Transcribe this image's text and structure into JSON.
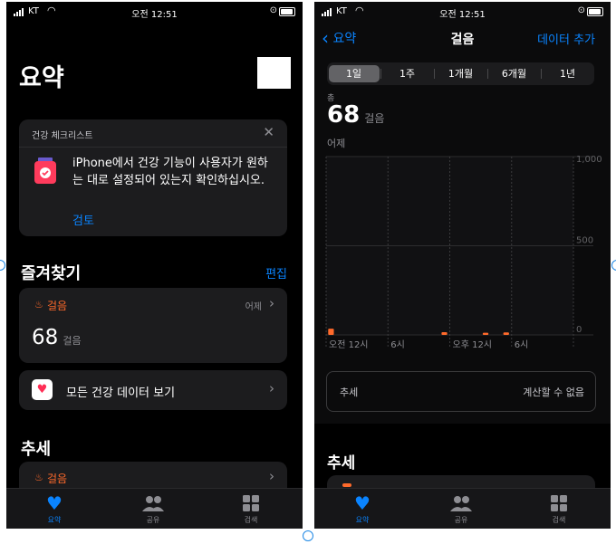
{
  "status_bar": {
    "carrier": "KT",
    "time": "오전 12:51"
  },
  "left": {
    "title": "요약",
    "checklist": {
      "header": "건강 체크리스트",
      "message": "iPhone에서 건강 기능이 사용자가 원하는 대로 설정되어 있는지 확인하십시오.",
      "action": "검토"
    },
    "favorites": {
      "title": "즐겨찾기",
      "edit": "편집",
      "steps_label": "걸음",
      "steps_date": "어제",
      "steps_value": "68",
      "steps_unit": "걸음",
      "all_data": "모든 건강 데이터 보기"
    },
    "trends": {
      "title": "추세",
      "item_label": "걸음"
    }
  },
  "tabs": {
    "summary": "요약",
    "sharing": "공유",
    "browse": "검색"
  },
  "right": {
    "back_label": "요약",
    "title": "걸음",
    "add_data": "데이터 추가",
    "segments": [
      "1일",
      "1주",
      "1개월",
      "6개월",
      "1년"
    ],
    "selected_segment": "1일",
    "total_label": "총",
    "total_value": "68",
    "total_unit": "걸음",
    "date_label": "어제",
    "trend_label": "추세",
    "trend_value": "계산할 수 없음",
    "trends_title": "추세"
  },
  "colors": {
    "accent": "#0a84ff",
    "steps": "#ff6a2b",
    "background": "#000000",
    "card": "#1c1c1e"
  },
  "chart_data": {
    "type": "bar",
    "x_ticks": [
      "오전 12시",
      "6시",
      "오후 12시",
      "6시"
    ],
    "y_ticks": [
      "1,000",
      "500",
      "0"
    ],
    "ylim": [
      0,
      1000
    ],
    "hours": [
      0,
      1,
      2,
      3,
      4,
      5,
      6,
      7,
      8,
      9,
      10,
      11,
      12,
      13,
      14,
      15,
      16,
      17,
      18,
      19,
      20,
      21,
      22,
      23
    ],
    "values": [
      35,
      0,
      0,
      0,
      0,
      0,
      0,
      0,
      0,
      0,
      0,
      15,
      0,
      0,
      0,
      12,
      0,
      14,
      0,
      0,
      0,
      0,
      0,
      0
    ]
  }
}
